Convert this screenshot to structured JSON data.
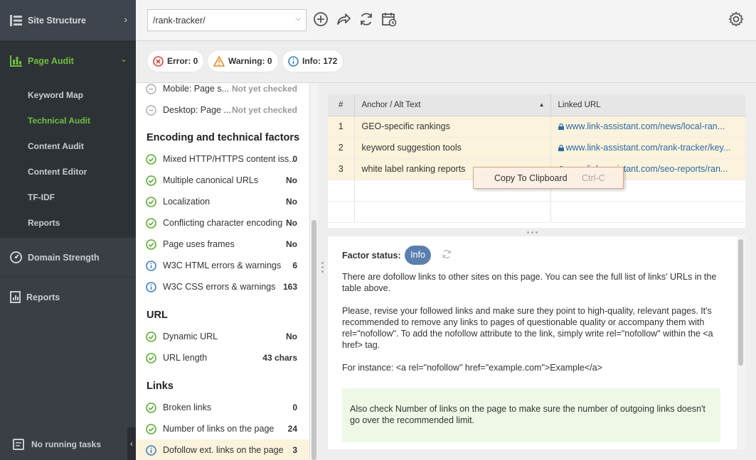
{
  "sidebar": {
    "site_structure": "Site Structure",
    "page_audit": "Page Audit",
    "sub_items": [
      "Keyword Map",
      "Technical Audit",
      "Content Audit",
      "Content Editor",
      "TF-IDF",
      "Reports"
    ],
    "domain_strength": "Domain Strength",
    "reports": "Reports",
    "tasks": "No running tasks",
    "active_color": "#6fbf3d"
  },
  "toolbar": {
    "url": "/rank-tracker/"
  },
  "badges": {
    "error": "Error: 0",
    "warning": "Warning: 0",
    "info": "Info: 172"
  },
  "factors": {
    "rows_top": [
      {
        "name": "Mobile: Page s...",
        "value": "Not yet checked"
      },
      {
        "name": "Desktop: Page ...",
        "value": "Not yet checked"
      }
    ],
    "encoding_title": "Encoding and technical factors",
    "encoding": [
      {
        "name": "Mixed HTTP/HTTPS content iss...",
        "value": "0"
      },
      {
        "name": "Multiple canonical URLs",
        "value": "No"
      },
      {
        "name": "Localization",
        "value": "No"
      },
      {
        "name": "Conflicting character encoding",
        "value": "No"
      },
      {
        "name": "Page uses frames",
        "value": "No"
      },
      {
        "name": "W3C HTML errors & warnings",
        "value": "6"
      },
      {
        "name": "W3C CSS errors & warnings",
        "value": "163"
      }
    ],
    "url_title": "URL",
    "url": [
      {
        "name": "Dynamic URL",
        "value": "No"
      },
      {
        "name": "URL length",
        "value": "43 chars"
      }
    ],
    "links_title": "Links",
    "links": [
      {
        "name": "Broken links",
        "value": "0"
      },
      {
        "name": "Number of links on the page",
        "value": "24"
      },
      {
        "name": "Dofollow ext. links on the page",
        "value": "3"
      }
    ]
  },
  "table": {
    "headers": [
      "#",
      "Anchor / Alt Text",
      "Linked URL"
    ],
    "rows": [
      {
        "num": "1",
        "anchor": "GEO-specific rankings",
        "url": "www.link-assistant.com/news/local-ran..."
      },
      {
        "num": "2",
        "anchor": "keyword suggestion tools",
        "url": "www.link-assistant.com/rank-tracker/key..."
      },
      {
        "num": "3",
        "anchor": "white label ranking reports",
        "url": "www.link-assistant.com/seo-reports/ran..."
      }
    ]
  },
  "context_menu": {
    "label": "Copy To Clipboard",
    "shortcut": "Ctrl-C"
  },
  "detail": {
    "status_label": "Factor status:",
    "status_value": "Info",
    "p1": "There are dofollow links to other sites on this page. You can see the full list of links' URLs in the table above.",
    "p2": "Please, revise your followed links and make sure they point to high-quality, relevant pages. It's recommended to remove any links to pages of questionable quality or accompany them with rel=\"nofollow\". To add the nofollow attribute to the link, simply write rel=\"nofollow\" within the <a href> tag.",
    "p3": "For instance: <a rel=\"nofollow\" href=\"example.com\">Example</a>",
    "note": "Also check Number of links on the page to make sure the number of outgoing links doesn't go over the recommended limit."
  }
}
